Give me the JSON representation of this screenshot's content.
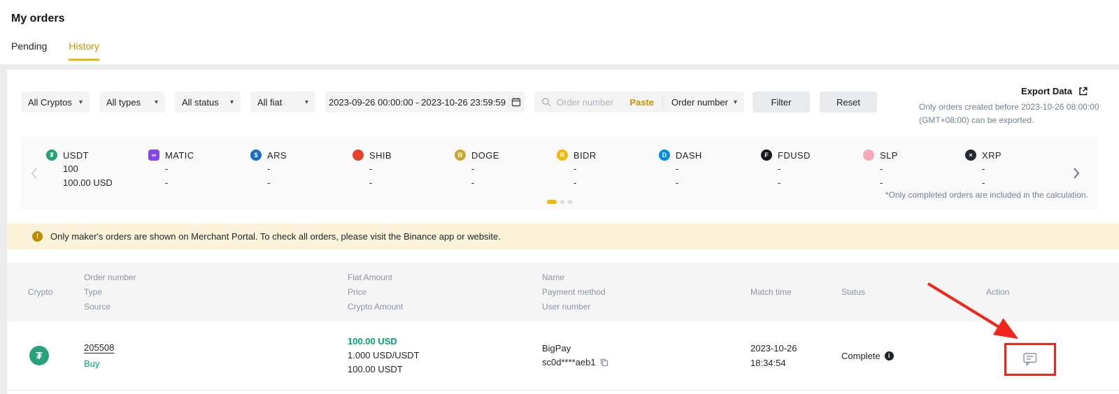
{
  "colors": {
    "accent_yellow": "#F0B90B",
    "text_brand": "#C99400",
    "green": "#03A66D",
    "annotation_red": "#F0261C",
    "banner_bg": "#FBF3D9",
    "text_primary": "#1E2329",
    "text_secondary": "#8B94A3"
  },
  "header": {
    "title": "My orders",
    "tabs": [
      {
        "label": "Pending"
      },
      {
        "label": "History"
      }
    ]
  },
  "filters": {
    "crypto_dropdown": "All Cryptos",
    "type_dropdown": "All types",
    "status_dropdown": "All status",
    "fiat_dropdown": "All fiat",
    "date_range": "2023-09-26 00:00:00 - 2023-10-26 23:59:59",
    "search_placeholder": "Order number",
    "paste_label": "Paste",
    "search_type": "Order number",
    "filter_button": "Filter",
    "reset_button": "Reset",
    "export_label": "Export Data",
    "export_note1": "Only orders created before 2023-10-26 08:00:00",
    "export_note2": "(GMT+08:00) can be exported."
  },
  "carousel": {
    "items": [
      {
        "symbol": "USDT",
        "value1": "100",
        "value2": "100.00 USD",
        "color": "#26A17B",
        "glyph": "₮"
      },
      {
        "symbol": "MATIC",
        "value1": "-",
        "value2": "-",
        "color": "#8247E5",
        "glyph": "∞"
      },
      {
        "symbol": "ARS",
        "value1": "-",
        "value2": "-",
        "color": "#1B6DC1",
        "glyph": "$"
      },
      {
        "symbol": "SHIB",
        "value1": "-",
        "value2": "-",
        "color": "#E8442D",
        "glyph": ""
      },
      {
        "symbol": "DOGE",
        "value1": "-",
        "value2": "-",
        "color": "#C9A633",
        "glyph": "Ð"
      },
      {
        "symbol": "BIDR",
        "value1": "-",
        "value2": "-",
        "color": "#F0B90B",
        "glyph": "R"
      },
      {
        "symbol": "DASH",
        "value1": "-",
        "value2": "-",
        "color": "#008CE7",
        "glyph": "D"
      },
      {
        "symbol": "FDUSD",
        "value1": "-",
        "value2": "-",
        "color": "#17181B",
        "glyph": "F"
      },
      {
        "symbol": "SLP",
        "value1": "-",
        "value2": "-",
        "color": "#F4A8B8",
        "glyph": ""
      },
      {
        "symbol": "XRP",
        "value1": "-",
        "value2": "-",
        "color": "#23292F",
        "glyph": "×"
      }
    ],
    "note": "*Only completed orders are included in the calculation."
  },
  "banner": {
    "icon_glyph": "!",
    "text": "Only maker's orders are shown on Merchant Portal. To check all orders, please visit the Binance app or website."
  },
  "table": {
    "headers": {
      "crypto": "Crypto",
      "order": [
        "Order number",
        "Type",
        "Source"
      ],
      "fiat": [
        "Fiat Amount",
        "Price",
        "Crypto Amount"
      ],
      "name": [
        "Name",
        "Payment method",
        "User number"
      ],
      "match": "Match time",
      "status": "Status",
      "action": "Action"
    },
    "row": {
      "crypto": "USDT",
      "crypto_glyph": "₮",
      "order_number": "205508",
      "type": "Buy",
      "fiat_amount": "100.00 USD",
      "price": "1.000 USD/USDT",
      "crypto_amount": "100.00 USDT",
      "payment_method": "BigPay",
      "user_number": "sc0d****aeb1",
      "match_date": "2023-10-26",
      "match_time": "18:34:54",
      "status": "Complete",
      "info_glyph": "i"
    }
  }
}
